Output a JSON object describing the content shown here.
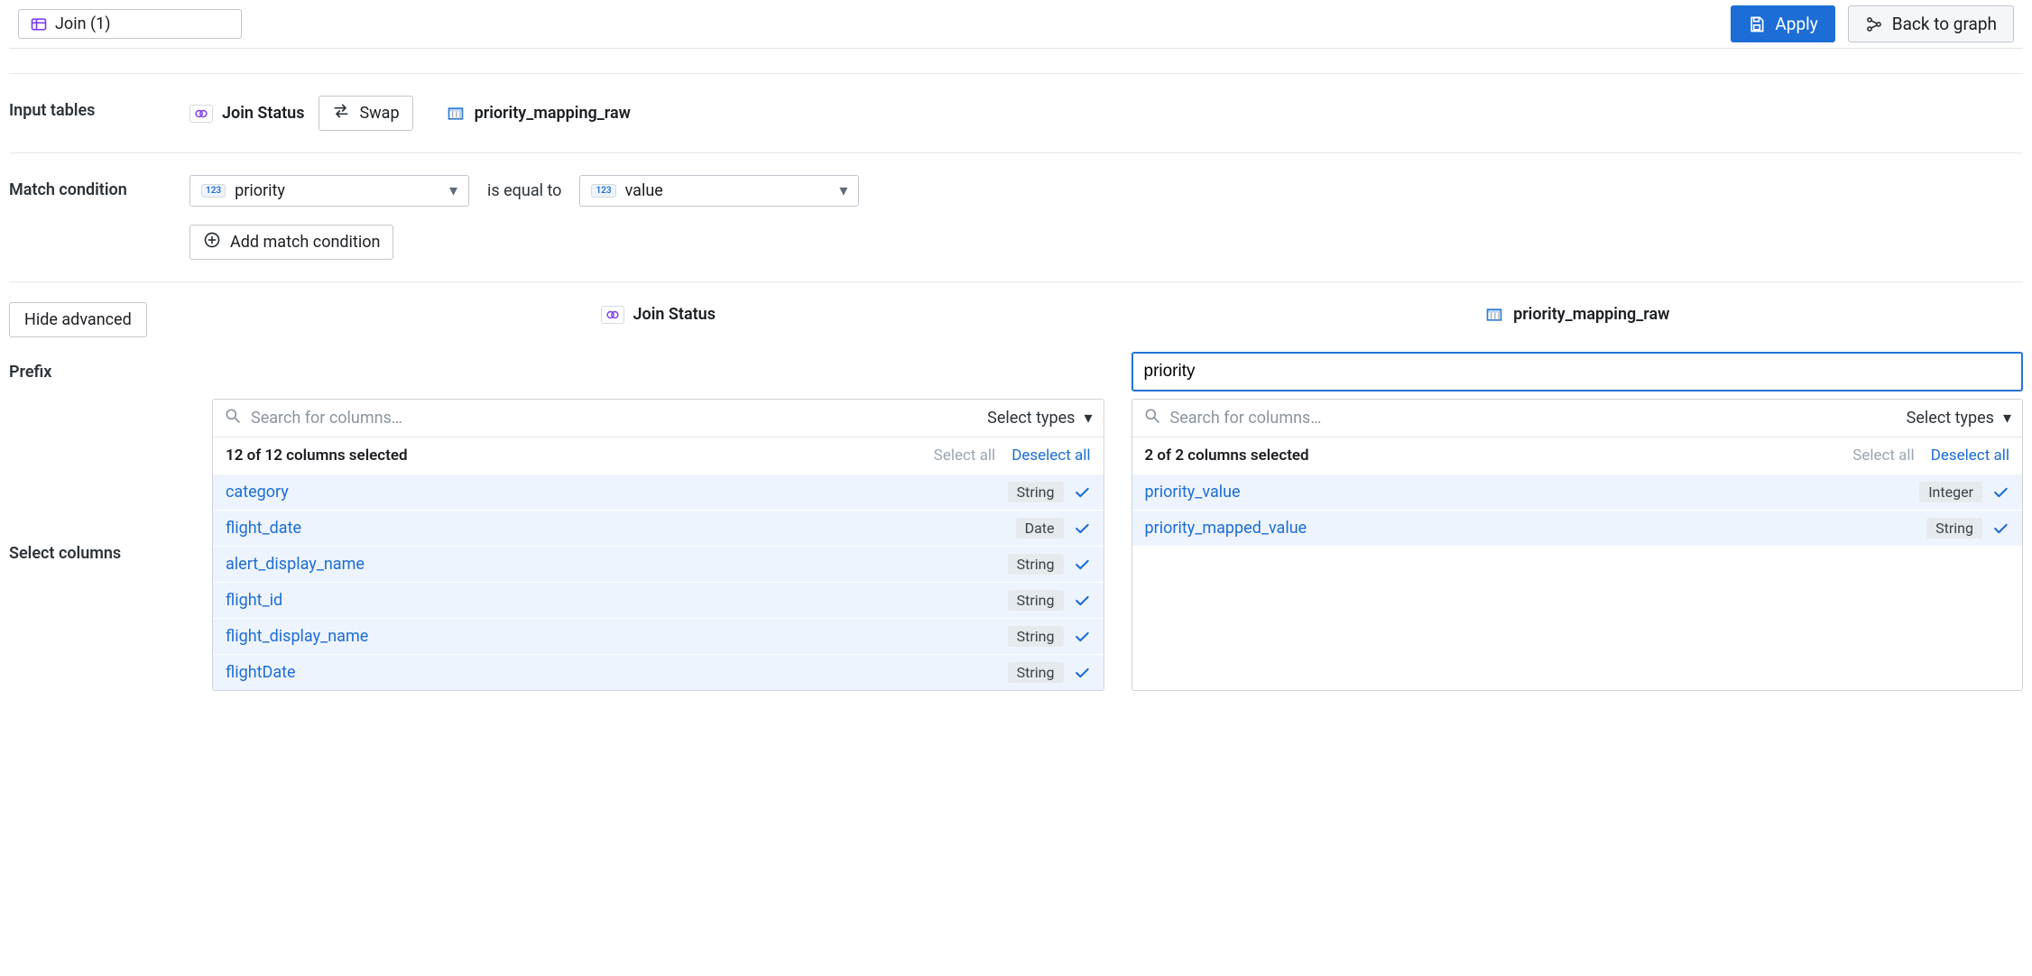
{
  "header": {
    "title": "Join (1)",
    "apply_label": "Apply",
    "back_label": "Back to graph"
  },
  "input_tables": {
    "label": "Input tables",
    "left_table": "Join Status",
    "swap_label": "Swap",
    "right_table": "priority_mapping_raw"
  },
  "match_condition": {
    "label": "Match condition",
    "left_field": "priority",
    "relation": "is equal to",
    "right_field": "value",
    "add_label": "Add match condition"
  },
  "advanced": {
    "hide_label": "Hide advanced",
    "prefix_label": "Prefix",
    "select_columns_label": "Select columns"
  },
  "panels": {
    "left": {
      "title": "Join Status",
      "search_placeholder": "Search for columns…",
      "select_types": "Select types",
      "count_label": "12 of 12 columns selected",
      "select_all": "Select all",
      "deselect_all": "Deselect all",
      "prefix_value": "",
      "columns": [
        {
          "name": "category",
          "type": "String"
        },
        {
          "name": "flight_date",
          "type": "Date"
        },
        {
          "name": "alert_display_name",
          "type": "String"
        },
        {
          "name": "flight_id",
          "type": "String"
        },
        {
          "name": "flight_display_name",
          "type": "String"
        },
        {
          "name": "flightDate",
          "type": "String"
        }
      ]
    },
    "right": {
      "title": "priority_mapping_raw",
      "search_placeholder": "Search for columns…",
      "select_types": "Select types",
      "count_label": "2 of 2 columns selected",
      "select_all": "Select all",
      "deselect_all": "Deselect all",
      "prefix_value": "priority",
      "columns": [
        {
          "name": "priority_value",
          "type": "Integer"
        },
        {
          "name": "priority_mapped_value",
          "type": "String"
        }
      ]
    }
  }
}
